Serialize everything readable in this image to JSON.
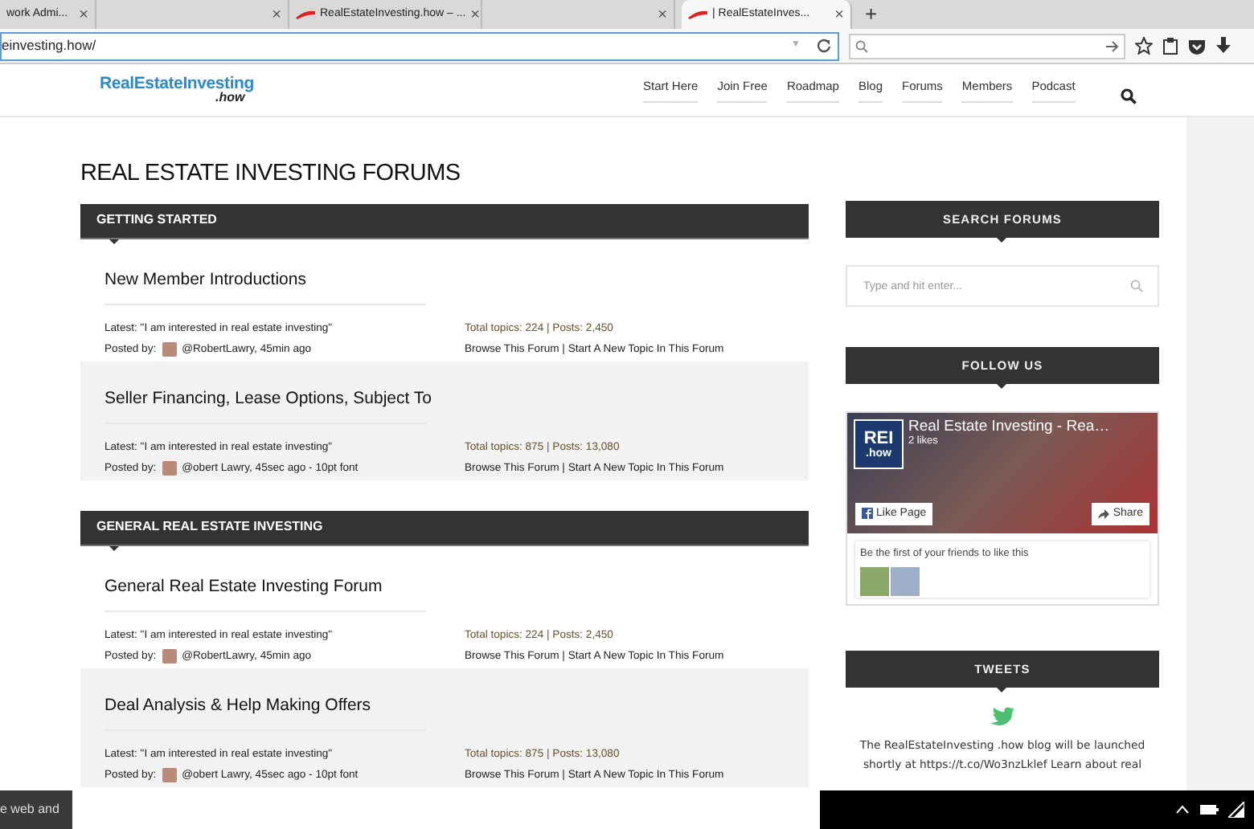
{
  "browser": {
    "tabs": [
      {
        "label": "work Admi...",
        "selected": false,
        "favicon": false
      },
      {
        "selected": false,
        "favicon": false
      },
      {
        "label": "RealEstateInvesting.how – ...",
        "selected": false,
        "favicon": true
      },
      {
        "selected": false,
        "favicon": false
      },
      {
        "label": "| RealEstateInves...",
        "selected": true,
        "favicon": true
      }
    ],
    "new_tab": "+",
    "close_glyph": "×",
    "url": "einvesting.how/",
    "url_dropdown": "▼"
  },
  "site": {
    "logo": {
      "name": "RealEstateInvesting",
      "suffix": ".how"
    },
    "nav": [
      "Start Here",
      "Join Free",
      "Roadmap",
      "Blog",
      "Forums",
      "Members",
      "Podcast"
    ]
  },
  "page_title": "REAL ESTATE INVESTING FORUMS",
  "sections": [
    {
      "title": "GETTING STARTED",
      "forums": [
        {
          "name": "New Member Introductions",
          "shaded": false,
          "latest": "Latest: \"I am interested in real estate investing\"",
          "posted_label": "Posted by:",
          "author": "@RobertLawry, 45min ago",
          "stats": "Total topics: 224 | Posts: 2,450",
          "links": [
            "Browse This Forum",
            "Start A New Topic In This Forum"
          ],
          "separator": "|"
        },
        {
          "name": "Seller Financing, Lease Options, Subject To",
          "shaded": true,
          "latest": "Latest: \"I am interested in real estate investing\"",
          "posted_label": "Posted by:",
          "author": "@obert Lawry, 45sec ago - 10pt font",
          "stats": "Total topics: 875 | Posts: 13,080",
          "links": [
            "Browse This Forum",
            "Start A New Topic In This Forum"
          ],
          "separator": "|"
        }
      ]
    },
    {
      "title": "GENERAL REAL ESTATE INVESTING",
      "forums": [
        {
          "name": "General Real Estate Investing Forum",
          "shaded": false,
          "latest": "Latest: \"I am interested in real estate investing\"",
          "posted_label": "Posted by:",
          "author": "@RobertLawry, 45min ago",
          "stats": "Total topics: 224 | Posts: 2,450",
          "links": [
            "Browse This Forum",
            "Start A New Topic In This Forum"
          ],
          "separator": "|"
        },
        {
          "name": "Deal Analysis & Help Making Offers",
          "shaded": true,
          "latest": "Latest: \"I am interested in real estate investing\"",
          "posted_label": "Posted by:",
          "author": "@obert Lawry, 45sec ago - 10pt font",
          "stats": "Total topics: 875 | Posts: 13,080",
          "links": [
            "Browse This Forum",
            "Start A New Topic In This Forum"
          ],
          "separator": "|"
        }
      ]
    }
  ],
  "sidebar": {
    "search": {
      "title": "SEARCH FORUMS",
      "placeholder": "Type and hit enter..."
    },
    "follow": {
      "title": "FOLLOW US",
      "badge_top": "REI",
      "badge_bottom": ".how",
      "page_name": "Real Estate Investing - Rea…",
      "likes": "2 likes",
      "like_button": "Like Page",
      "share_button": "Share",
      "friends_text": "Be the first of your friends to like this"
    },
    "tweets": {
      "title": "TWEETS",
      "text": "The RealEstateInvesting .how blog will be launched shortly at https://t.co/Wo3nzLklef Learn about real"
    }
  },
  "taskbar": {
    "search_fragment": "e web and"
  }
}
